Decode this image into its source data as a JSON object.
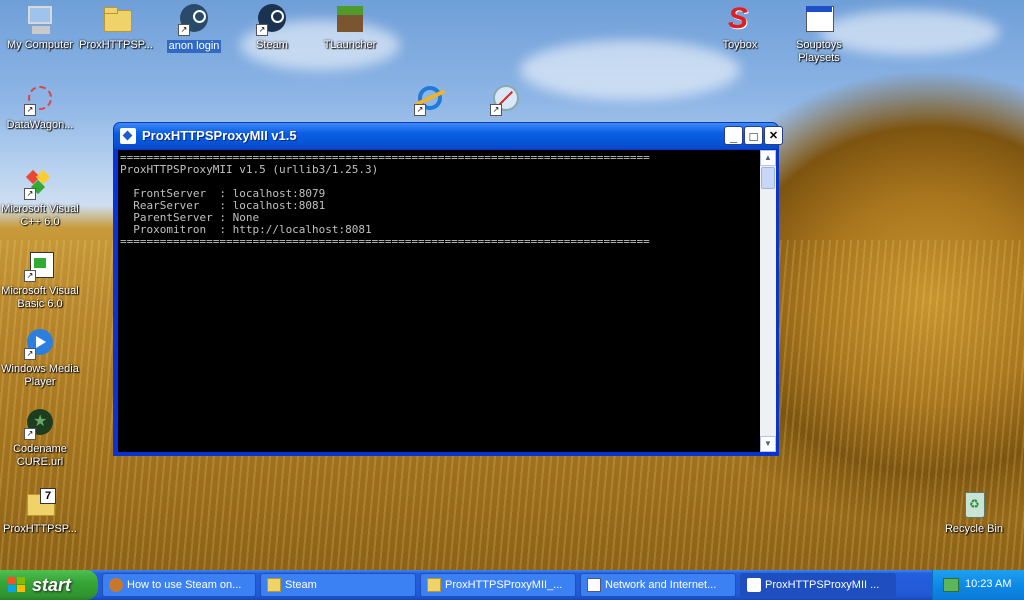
{
  "desktop": {
    "icons": [
      {
        "label": "My Computer"
      },
      {
        "label": "ProxHTTPSP..."
      },
      {
        "label": "anon login"
      },
      {
        "label": "Steam"
      },
      {
        "label": "TLauncher"
      },
      {
        "label": "Toybox"
      },
      {
        "label": "Souptoys Playsets"
      },
      {
        "label": "DataWagon..."
      },
      {
        "label": "Microsoft Visual C++ 6.0"
      },
      {
        "label": "Microsoft Visual Basic 6.0"
      },
      {
        "label": "Windows Media Player"
      },
      {
        "label": "Codename CURE.url"
      },
      {
        "label": "ProxHTTPSP..."
      },
      {
        "label": "Recycle Bin"
      }
    ]
  },
  "window": {
    "title": "ProxHTTPSProxyMII v1.5",
    "console_text": "================================================================================\nProxHTTPSProxyMII v1.5 (urllib3/1.25.3)\n\n  FrontServer  : localhost:8079\n  RearServer   : localhost:8081\n  ParentServer : None\n  Proxomitron  : http://localhost:8081\n================================================================================",
    "min_symbol": "_",
    "max_symbol": "□",
    "close_symbol": "✕"
  },
  "taskbar": {
    "start_label": "start",
    "tasks": [
      {
        "label": "How to use Steam on..."
      },
      {
        "label": "Steam"
      },
      {
        "label": "ProxHTTPSProxyMII_..."
      },
      {
        "label": "Network and Internet..."
      },
      {
        "label": "ProxHTTPSProxyMII ..."
      }
    ],
    "clock": "10:23 AM"
  },
  "colors": {
    "title_bar": "#0a5ee4",
    "taskbar": "#245edc",
    "start": "#37a537",
    "console_bg": "#000000",
    "console_text": "#c0c0c0"
  }
}
